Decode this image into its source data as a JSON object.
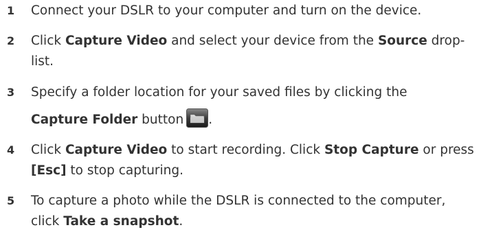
{
  "steps": [
    {
      "number": "1",
      "text": "Connect your DSLR to your computer and turn on the device."
    },
    {
      "number": "2",
      "pre": "Click ",
      "bold1": "Capture Video",
      "mid": " and select your device from the ",
      "bold2": "Source",
      "post": " drop-",
      "line2": "list."
    },
    {
      "number": "3",
      "line1": "Specify a folder location for your saved files by clicking the",
      "bold1": "Capture Folder",
      "post": " button",
      "end": "."
    },
    {
      "number": "4",
      "pre": "Click ",
      "bold1": "Capture Video",
      "mid": " to start recording. Click ",
      "bold2": "Stop Capture",
      "post": " or press",
      "bold3": "[Esc]",
      "line2": " to stop capturing."
    },
    {
      "number": "5",
      "line1": "To capture a photo while the DSLR is connected to the computer,",
      "pre2": "click ",
      "bold1": "Take a snapshot",
      "end": "."
    }
  ],
  "icons": {
    "capture_folder": "folder-icon"
  },
  "colors": {
    "text": "#333333",
    "number": "#333333"
  }
}
